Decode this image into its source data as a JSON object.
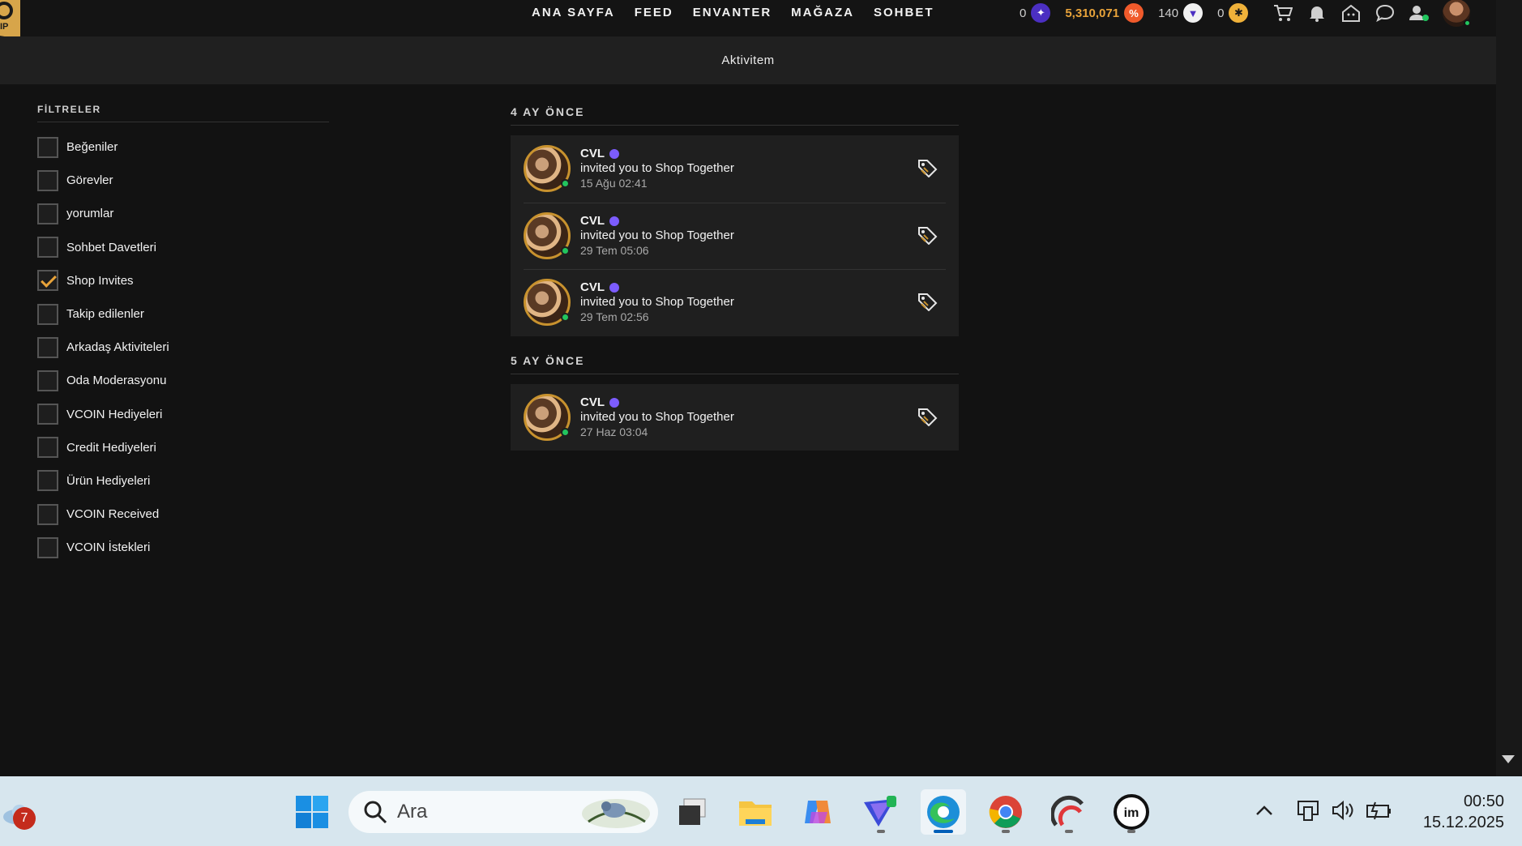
{
  "vip": {
    "label": "IP"
  },
  "nav": {
    "links": [
      "ANA SAYFA",
      "FEED",
      "ENVANTER",
      "MAĞAZA",
      "SOHBET"
    ],
    "currencies": [
      {
        "value": "0",
        "icon": "purple-gem-icon",
        "color": "#4b2fc2"
      },
      {
        "value": "5,310,071",
        "icon": "credits-icon",
        "color": "#f05a2b"
      },
      {
        "value": "140",
        "icon": "vcoin-icon",
        "color": "#f2f2f2"
      },
      {
        "value": "0",
        "icon": "star-token-icon",
        "color": "#f0b23a"
      }
    ]
  },
  "subheader": {
    "title": "Aktivitem"
  },
  "filters": {
    "title": "FİLTRELER",
    "items": [
      {
        "label": "Beğeniler",
        "checked": false
      },
      {
        "label": "Görevler",
        "checked": false
      },
      {
        "label": "yorumlar",
        "checked": false
      },
      {
        "label": "Sohbet Davetleri",
        "checked": false
      },
      {
        "label": "Shop Invites",
        "checked": true
      },
      {
        "label": "Takip edilenler",
        "checked": false
      },
      {
        "label": "Arkadaş Aktiviteleri",
        "checked": false
      },
      {
        "label": "Oda Moderasyonu",
        "checked": false
      },
      {
        "label": "VCOIN Hediyeleri",
        "checked": false
      },
      {
        "label": "Credit Hediyeleri",
        "checked": false
      },
      {
        "label": "Ürün Hediyeleri",
        "checked": false
      },
      {
        "label": "VCOIN Received",
        "checked": false
      },
      {
        "label": "VCOIN İstekleri",
        "checked": false
      }
    ]
  },
  "feed": {
    "groups": [
      {
        "title": "4 AY ÖNCE",
        "items": [
          {
            "name": "CVL",
            "message": "invited you to Shop Together",
            "time": "15 Ağu 02:41"
          },
          {
            "name": "CVL",
            "message": "invited you to Shop Together",
            "time": "29 Tem 05:06"
          },
          {
            "name": "CVL",
            "message": "invited you to Shop Together",
            "time": "29 Tem 02:56"
          }
        ]
      },
      {
        "title": "5 AY ÖNCE",
        "items": [
          {
            "name": "CVL",
            "message": "invited you to Shop Together",
            "time": "27 Haz 03:04"
          }
        ]
      }
    ]
  },
  "taskbar": {
    "weather_badge": "7",
    "search_placeholder": "Ara",
    "clock_time": "00:50",
    "clock_date": "15.12.2025"
  },
  "colors": {
    "accent_gold": "#e8a33a",
    "online_green": "#22c55e",
    "vip_gold": "#d7a54a"
  }
}
